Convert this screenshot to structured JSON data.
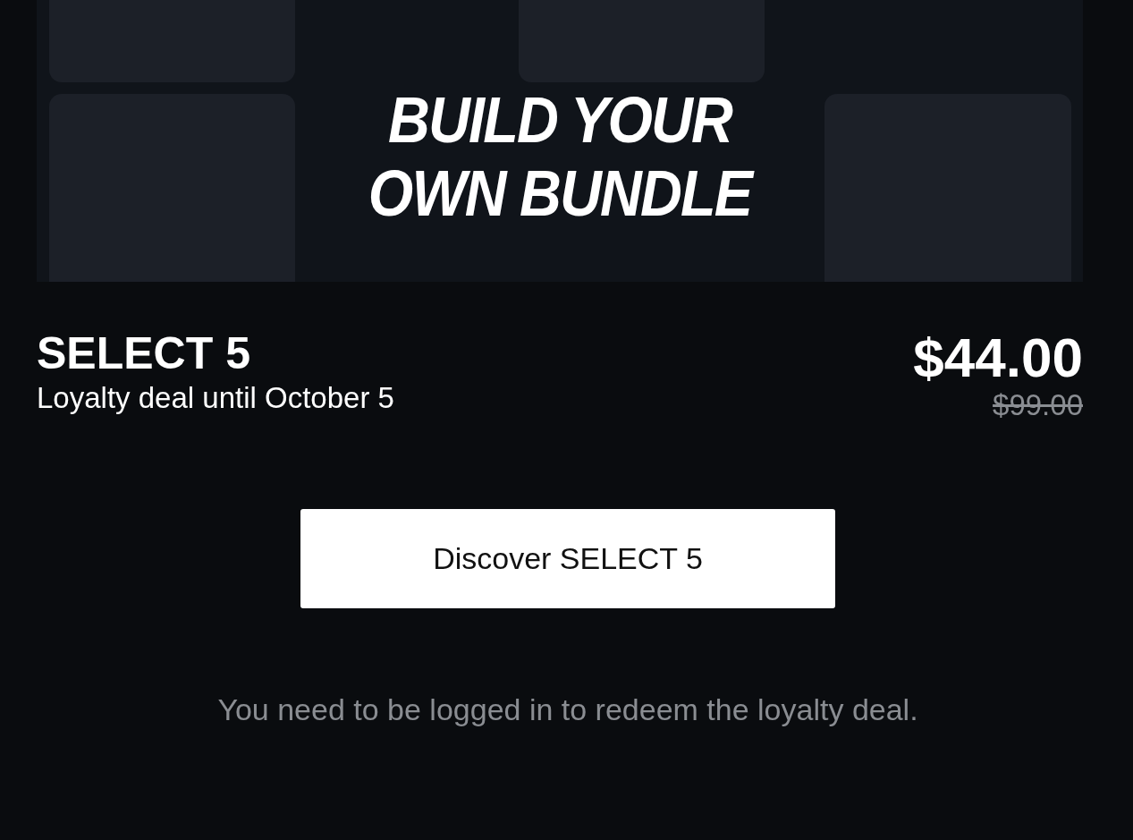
{
  "banner": {
    "title": "BUILD YOUR OWN BUNDLE"
  },
  "product": {
    "name": "SELECT 5",
    "subtitle": "Loyalty deal until October 5",
    "price": "$44.00",
    "original_price": "$99.00"
  },
  "button": {
    "label": "Discover SELECT 5"
  },
  "note": "You need to be logged in to redeem the loyalty deal."
}
